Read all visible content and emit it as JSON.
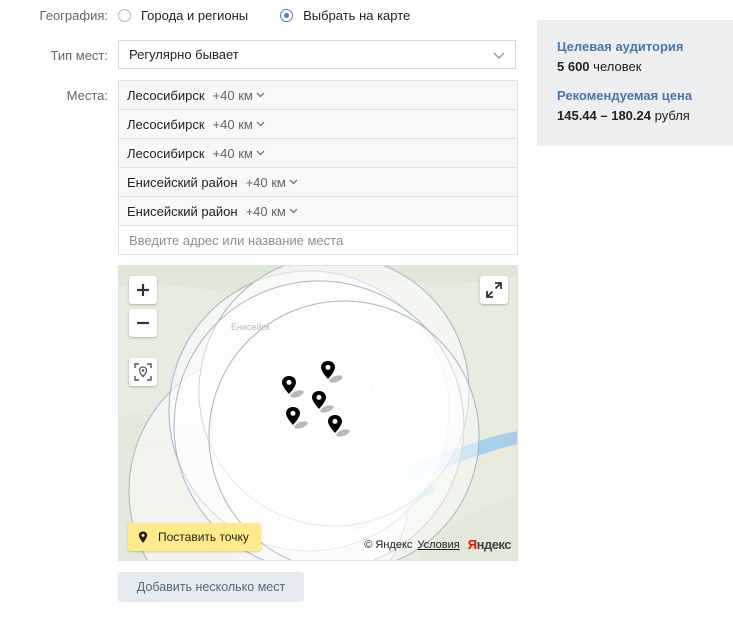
{
  "geography": {
    "label": "География:",
    "options": [
      "Города и регионы",
      "Выбрать на карте"
    ],
    "selected": 1
  },
  "place_type": {
    "label": "Тип мест:",
    "value": "Регулярно бывает"
  },
  "places": {
    "label": "Места:",
    "items": [
      {
        "name": "Лесосибирск",
        "radius": "+40 км"
      },
      {
        "name": "Лесосибирск",
        "radius": "+40 км"
      },
      {
        "name": "Лесосибирск",
        "radius": "+40 км"
      },
      {
        "name": "Енисейский район",
        "radius": "+40 км"
      },
      {
        "name": "Енисейский район",
        "radius": "+40 км"
      }
    ],
    "input_placeholder": "Введите адрес или название места"
  },
  "map": {
    "place_point_label": "Поставить точку",
    "copyright": "© Яндекс",
    "terms_link": "Условия",
    "logo": "Яндекс",
    "logo_first": "Я",
    "logo_rest": "ндекс",
    "icons": {
      "zoom_in": "plus-icon",
      "zoom_out": "minus-icon",
      "locate": "locate-icon",
      "fullscreen": "expand-icon",
      "pin": "map-pin-icon"
    }
  },
  "add_button": "Добавить несколько мест",
  "audience": {
    "title": "Целевая аудитория",
    "count": "5 600",
    "unit": "человек"
  },
  "price": {
    "title": "Рекомендуемая цена",
    "range": "145.44 – 180.24",
    "unit": "рубля"
  },
  "colors": {
    "accent": "#4a76a8",
    "radio": "#5181b8",
    "button_bg": "#e5ebf1",
    "place_point_bg": "#ffeb8a",
    "panel_bg": "#edeef0"
  }
}
